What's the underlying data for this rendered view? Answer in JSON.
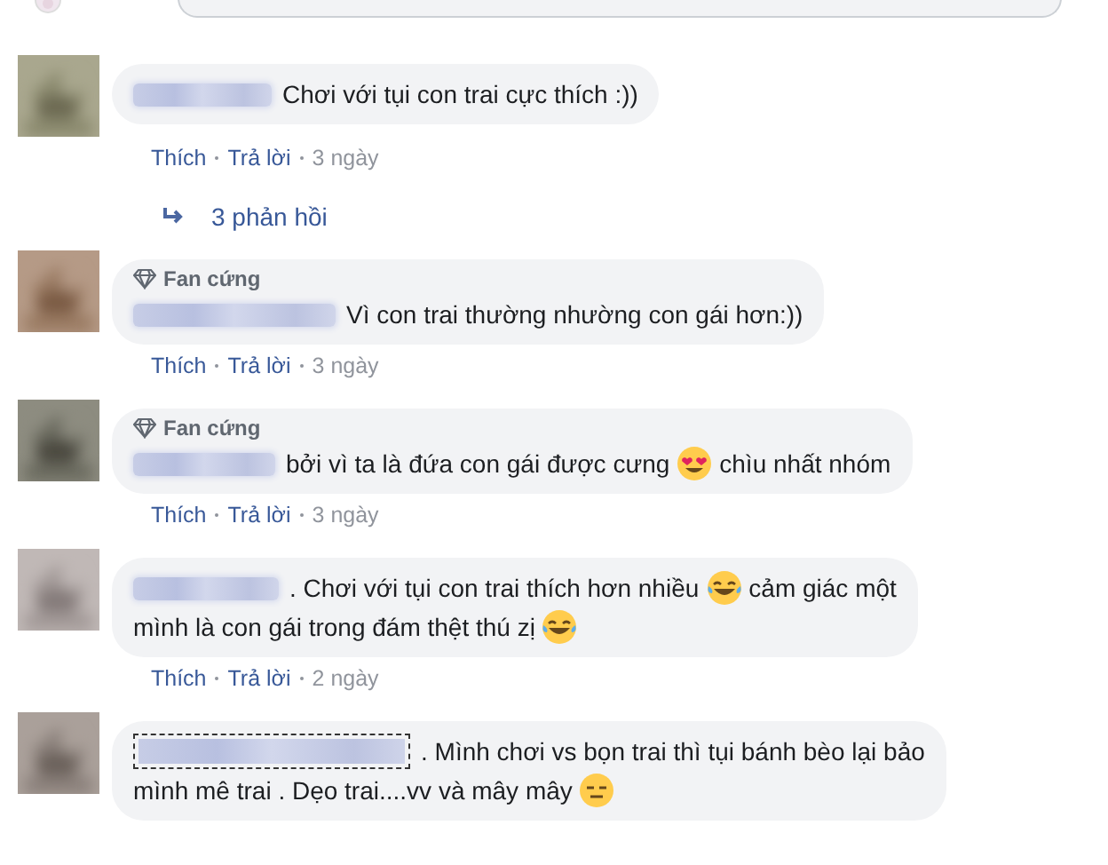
{
  "composer": {
    "kind": "comment-field"
  },
  "comments": [
    {
      "name_focused": false,
      "lines": [
        [
          {
            "kind": "text",
            "text": "Chơi với tụi con trai cực thích :))"
          }
        ]
      ],
      "actions": {
        "like": "Thích",
        "reply": "Trả lời",
        "time": "3 ngày"
      },
      "replies": "3 phản hồi"
    },
    {
      "badge": "Fan cứng",
      "name_focused": false,
      "lines": [
        [
          {
            "kind": "text",
            "text": "Vì con trai thường nhường con gái hơn:))"
          }
        ]
      ],
      "actions": {
        "like": "Thích",
        "reply": "Trả lời",
        "time": "3 ngày"
      }
    },
    {
      "badge": "Fan cứng",
      "name_focused": false,
      "lines": [
        [
          {
            "kind": "text",
            "text": "bởi vì ta là đứa con gái được cưng"
          },
          {
            "kind": "heart_eyes"
          },
          {
            "kind": "text",
            "text": "chìu nhất nhóm"
          }
        ]
      ],
      "actions": {
        "like": "Thích",
        "reply": "Trả lời",
        "time": "3 ngày"
      }
    },
    {
      "name_focused": false,
      "lines": [
        [
          {
            "kind": "text",
            "text": ". Chơi với tụi con trai thích hơn nhiều"
          },
          {
            "kind": "laughing"
          },
          {
            "kind": "text",
            "text": "cảm giác một"
          }
        ],
        [
          {
            "kind": "text",
            "text": "mình là con gái trong đám thệt thú zị"
          },
          {
            "kind": "laughing"
          }
        ]
      ],
      "actions": {
        "like": "Thích",
        "reply": "Trả lời",
        "time": "2 ngày"
      }
    },
    {
      "name_focused": true,
      "lines": [
        [
          {
            "kind": "text",
            "text": ". Mình chơi vs bọn trai thì tụi bánh bèo lại bảo"
          }
        ],
        [
          {
            "kind": "text",
            "text": "mình mê trai . Dẹo trai....vv và mây mây"
          },
          {
            "kind": "expressionless"
          }
        ]
      ]
    }
  ]
}
